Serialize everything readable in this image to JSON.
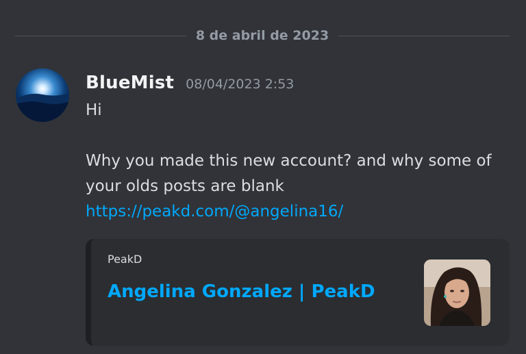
{
  "date_divider": {
    "label": "8 de abril de 2023"
  },
  "message": {
    "username": "BlueMist",
    "timestamp": "08/04/2023 2:53",
    "lines": {
      "line1": "Hi",
      "line2": "Why you made this new account? and why some of",
      "line3": "your olds posts are blank",
      "link": "https://peakd.com/@angelina16/"
    }
  },
  "embed": {
    "provider": "PeakD",
    "title": "Angelina Gonzalez | PeakD"
  },
  "colors": {
    "background": "#313338",
    "link": "#00a8fc",
    "username": "#f2f3f5",
    "timestamp": "#949ba4",
    "embed_background": "#2b2d31"
  }
}
